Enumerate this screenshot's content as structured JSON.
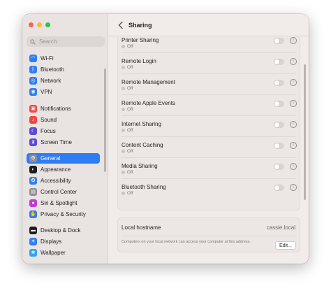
{
  "sidebar": {
    "search_placeholder": "Search",
    "items": [
      {
        "label": "Wi-Fi",
        "icon": "wifi-icon",
        "color": "#2f7ff0"
      },
      {
        "label": "Bluetooth",
        "icon": "bluetooth-icon",
        "color": "#2f7ff0"
      },
      {
        "label": "Network",
        "icon": "network-icon",
        "color": "#2f7ff0"
      },
      {
        "label": "VPN",
        "icon": "vpn-icon",
        "color": "#2f7ff0"
      },
      {
        "label": "Notifications",
        "icon": "notifications-icon",
        "color": "#f0483e"
      },
      {
        "label": "Sound",
        "icon": "sound-icon",
        "color": "#f0483e"
      },
      {
        "label": "Focus",
        "icon": "focus-icon",
        "color": "#5b4bd6"
      },
      {
        "label": "Screen Time",
        "icon": "screen-time-icon",
        "color": "#5b4bd6"
      },
      {
        "label": "General",
        "icon": "gear-icon",
        "color": "#8e8e93",
        "active": true
      },
      {
        "label": "Appearance",
        "icon": "appearance-icon",
        "color": "#1c1c1e"
      },
      {
        "label": "Accessibility",
        "icon": "accessibility-icon",
        "color": "#2f7ff0"
      },
      {
        "label": "Control Center",
        "icon": "control-center-icon",
        "color": "#8e8e93"
      },
      {
        "label": "Siri & Spotlight",
        "icon": "siri-icon",
        "color": "#c33bd6"
      },
      {
        "label": "Privacy & Security",
        "icon": "privacy-icon",
        "color": "#2f7ff0"
      },
      {
        "label": "Desktop & Dock",
        "icon": "desktop-dock-icon",
        "color": "#1c1c1e"
      },
      {
        "label": "Displays",
        "icon": "displays-icon",
        "color": "#2f7ff0"
      },
      {
        "label": "Wallpaper",
        "icon": "wallpaper-icon",
        "color": "#33a3ee"
      }
    ]
  },
  "header": {
    "title": "Sharing"
  },
  "sharing": {
    "services": [
      {
        "name": "Printer Sharing",
        "status": "Off"
      },
      {
        "name": "Remote Login",
        "status": "Off"
      },
      {
        "name": "Remote Management",
        "status": "Off"
      },
      {
        "name": "Remote Apple Events",
        "status": "Off"
      },
      {
        "name": "Internet Sharing",
        "status": "Off"
      },
      {
        "name": "Content Caching",
        "status": "Off"
      },
      {
        "name": "Media Sharing",
        "status": "Off"
      },
      {
        "name": "Bluetooth Sharing",
        "status": "Off"
      }
    ],
    "hostname_label": "Local hostname",
    "hostname_value": "cassie.local",
    "hostname_note": "Computers on your local network can access your computer at this address.",
    "edit_label": "Edit...",
    "help_label": "?"
  },
  "colors": {
    "accent": "#2e7df6",
    "sidebar_bg": "#e9e3e2",
    "content_bg": "#f1ebe9"
  }
}
